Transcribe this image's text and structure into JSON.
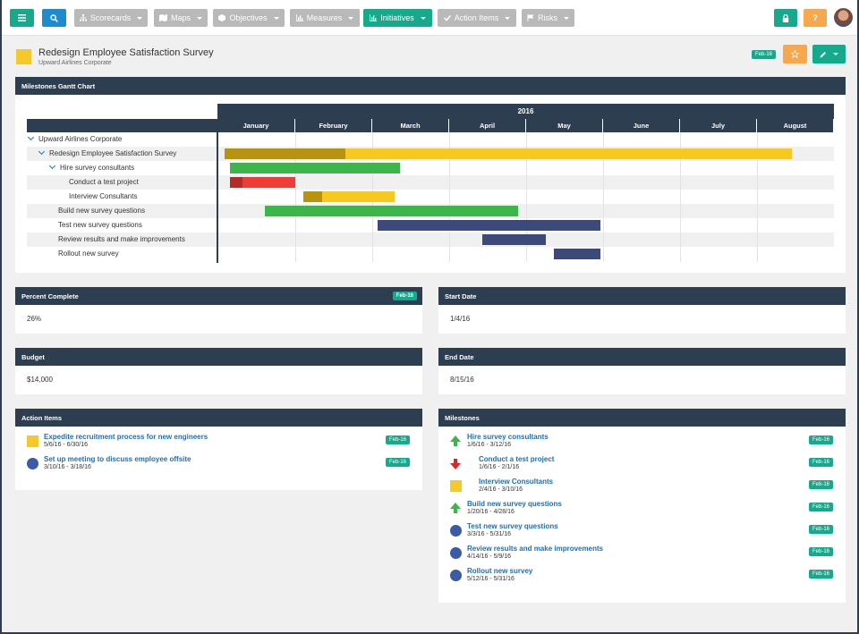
{
  "nav": {
    "scorecards": "Scorecards",
    "maps": "Maps",
    "objectives": "Objectives",
    "measures": "Measures",
    "initiatives": "Initiatives",
    "action_items": "Action Items",
    "risks": "Risks",
    "help": "?"
  },
  "header": {
    "title": "Redesign Employee Satisfaction Survey",
    "subtitle": "Upward Airlines Corporate",
    "period": "Feb-16"
  },
  "gantt": {
    "title": "Milestones Gantt Chart",
    "year": "2016",
    "months": [
      "January",
      "February",
      "March",
      "April",
      "May",
      "June",
      "July",
      "August"
    ],
    "rows": [
      {
        "label": "Upward Airlines Corporate",
        "level": 0,
        "expanded": true
      },
      {
        "label": "Redesign Employee Satisfaction Survey",
        "level": 1,
        "expanded": true
      },
      {
        "label": "Hire survey consultants",
        "level": 2,
        "expanded": true
      },
      {
        "label": "Conduct a test project",
        "level": 3
      },
      {
        "label": "Interview Consultants",
        "level": 3
      },
      {
        "label": "Build new survey questions",
        "level": 2
      },
      {
        "label": "Test new survey questions",
        "level": 2
      },
      {
        "label": "Review results and make improvements",
        "level": 2
      },
      {
        "label": "Rollout new survey",
        "level": 2
      }
    ],
    "colors": {
      "yellow": "#f7c81e",
      "yellow_dark": "#b8930d",
      "green": "#3cb54a",
      "red": "#ee3d36",
      "red_dark": "#b52b27",
      "navy": "#3b4a7a"
    }
  },
  "percent_complete": {
    "label": "Percent Complete",
    "period": "Feb-16",
    "value": "26%"
  },
  "start_date": {
    "label": "Start Date",
    "value": "1/4/16"
  },
  "budget": {
    "label": "Budget",
    "value": "$14,000"
  },
  "end_date": {
    "label": "End Date",
    "value": "8/15/16"
  },
  "action_items": {
    "label": "Action Items",
    "items": [
      {
        "title": "Expedite recruitment process for new engineers",
        "dates": "5/6/16 - 6/30/16",
        "period": "Feb-16",
        "icon": "yellow-square"
      },
      {
        "title": "Set up meeting to discuss employee offsite",
        "dates": "3/10/16 - 3/18/16",
        "period": "Feb-16",
        "icon": "blue-circle"
      }
    ]
  },
  "milestones": {
    "label": "Milestones",
    "items": [
      {
        "title": "Hire survey consultants",
        "dates": "1/6/16 - 3/12/16",
        "period": "Feb-16",
        "icon": "green-up-arrow"
      },
      {
        "title": "Conduct a test project",
        "dates": "1/6/16 - 2/1/16",
        "period": "Feb-16",
        "icon": "red-down-arrow"
      },
      {
        "title": "Interview Consultants",
        "dates": "2/4/16 - 3/10/16",
        "period": "Feb-16",
        "icon": "yellow-square"
      },
      {
        "title": "Build new survey questions",
        "dates": "1/20/16 - 4/28/16",
        "period": "Feb-16",
        "icon": "green-up-arrow"
      },
      {
        "title": "Test new survey questions",
        "dates": "3/3/16 - 5/31/16",
        "period": "Feb-16",
        "icon": "blue-circle"
      },
      {
        "title": "Review results and make improvements",
        "dates": "4/14/16 - 5/9/16",
        "period": "Feb-16",
        "icon": "blue-circle"
      },
      {
        "title": "Rollout new survey",
        "dates": "5/12/16 - 5/31/16",
        "period": "Feb-16",
        "icon": "blue-circle"
      }
    ]
  }
}
